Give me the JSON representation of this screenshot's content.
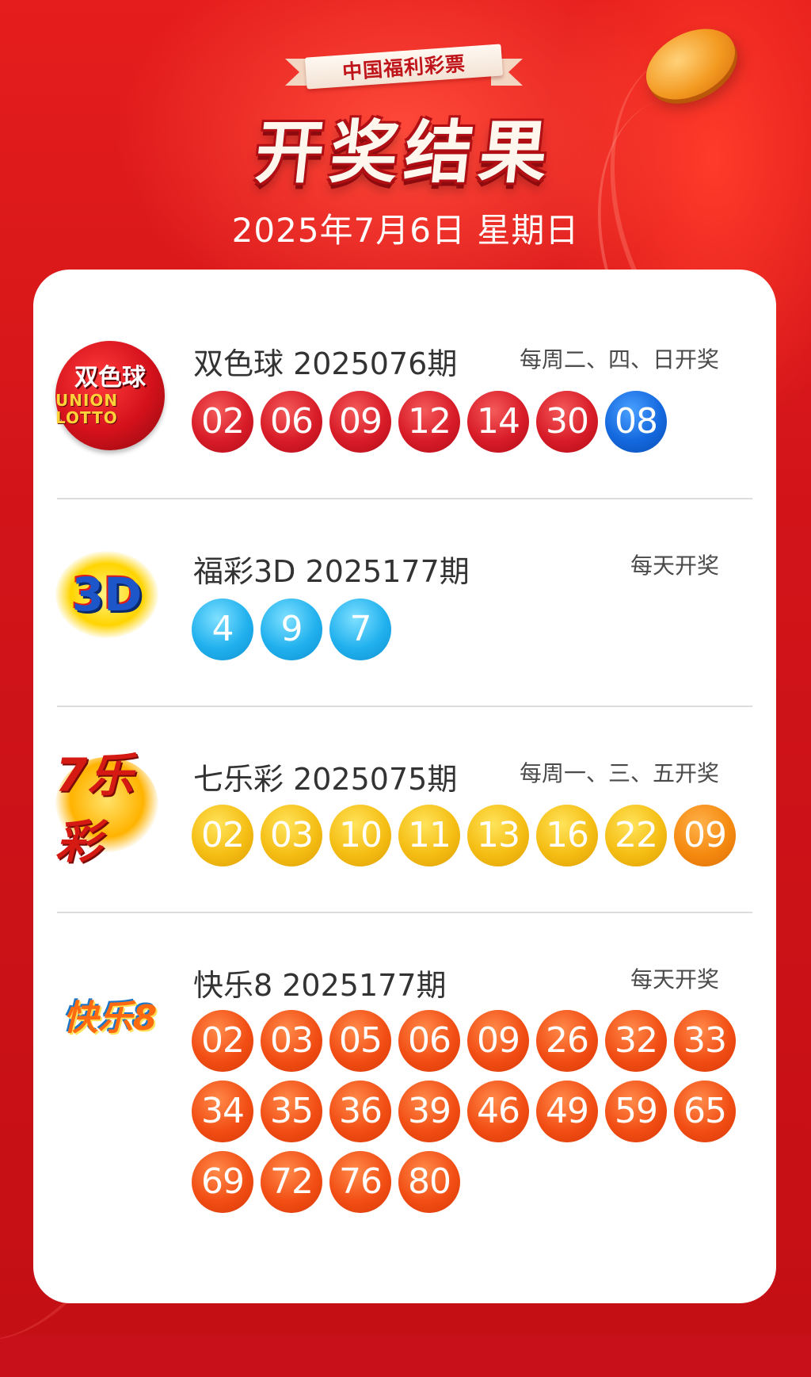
{
  "header": {
    "brand": "中国福利彩票",
    "title": "开奖结果",
    "date": "2025年7月6日 星期日"
  },
  "colors": {
    "background": "#d11419",
    "red_ball": "#d81c28",
    "blue_ball": "#1468de",
    "sky_ball": "#21b1ee",
    "gold_ball": "#f5be14",
    "orange_ball": "#f58a10",
    "kl8_ball": "#f24e14"
  },
  "games": [
    {
      "logo": "双色球",
      "logo_icon": "union-lotto-logo",
      "logo_sub": "UNION LOTTO",
      "title": "双色球 2025076期",
      "schedule": "每周二、四、日开奖",
      "balls": [
        {
          "n": "02",
          "color": "red"
        },
        {
          "n": "06",
          "color": "red"
        },
        {
          "n": "09",
          "color": "red"
        },
        {
          "n": "12",
          "color": "red"
        },
        {
          "n": "14",
          "color": "red"
        },
        {
          "n": "30",
          "color": "red"
        },
        {
          "n": "08",
          "color": "blue"
        }
      ]
    },
    {
      "logo": "3D",
      "logo_icon": "fucai-3d-logo",
      "title": "福彩3D 2025177期",
      "schedule": "每天开奖",
      "balls": [
        {
          "n": "4",
          "color": "sky"
        },
        {
          "n": "9",
          "color": "sky"
        },
        {
          "n": "7",
          "color": "sky"
        }
      ]
    },
    {
      "logo": "7乐彩",
      "logo_icon": "qilecai-logo",
      "title": "七乐彩 2025075期",
      "schedule": "每周一、三、五开奖",
      "balls": [
        {
          "n": "02",
          "color": "gold"
        },
        {
          "n": "03",
          "color": "gold"
        },
        {
          "n": "10",
          "color": "gold"
        },
        {
          "n": "11",
          "color": "gold"
        },
        {
          "n": "13",
          "color": "gold"
        },
        {
          "n": "16",
          "color": "gold"
        },
        {
          "n": "22",
          "color": "gold"
        },
        {
          "n": "09",
          "color": "orange"
        }
      ]
    },
    {
      "logo": "快乐8",
      "logo_icon": "kuaile8-logo",
      "title": "快乐8 2025177期",
      "schedule": "每天开奖",
      "balls": [
        {
          "n": "02",
          "color": "kl"
        },
        {
          "n": "03",
          "color": "kl"
        },
        {
          "n": "05",
          "color": "kl"
        },
        {
          "n": "06",
          "color": "kl"
        },
        {
          "n": "09",
          "color": "kl"
        },
        {
          "n": "26",
          "color": "kl"
        },
        {
          "n": "32",
          "color": "kl"
        },
        {
          "n": "33",
          "color": "kl"
        },
        {
          "n": "34",
          "color": "kl"
        },
        {
          "n": "35",
          "color": "kl"
        },
        {
          "n": "36",
          "color": "kl"
        },
        {
          "n": "39",
          "color": "kl"
        },
        {
          "n": "46",
          "color": "kl"
        },
        {
          "n": "49",
          "color": "kl"
        },
        {
          "n": "59",
          "color": "kl"
        },
        {
          "n": "65",
          "color": "kl"
        },
        {
          "n": "69",
          "color": "kl"
        },
        {
          "n": "72",
          "color": "kl"
        },
        {
          "n": "76",
          "color": "kl"
        },
        {
          "n": "80",
          "color": "kl"
        }
      ]
    }
  ]
}
